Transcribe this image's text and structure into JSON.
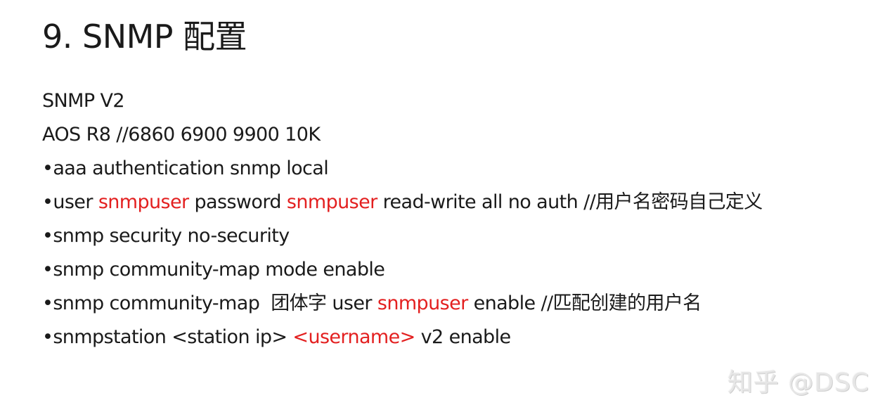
{
  "title": "9. SNMP 配置",
  "lines": [
    [
      {
        "text": "SNMP V2"
      }
    ],
    [
      {
        "text": "AOS R8 //6860 6900 9900 10K"
      }
    ],
    [
      {
        "text": "•aaa authentication snmp local"
      }
    ],
    [
      {
        "text": "•user "
      },
      {
        "text": "snmpuser",
        "highlight": true
      },
      {
        "text": " password "
      },
      {
        "text": "snmpuser",
        "highlight": true
      },
      {
        "text": " read-write all no auth //用户名密码自己定义"
      }
    ],
    [
      {
        "text": "•snmp security no-security"
      }
    ],
    [
      {
        "text": "•snmp community-map mode enable"
      }
    ],
    [
      {
        "text": "•snmp community-map  团体字 user "
      },
      {
        "text": "snmpuser",
        "highlight": true
      },
      {
        "text": " enable //匹配创建的用户名"
      }
    ],
    [
      {
        "text": "•snmpstation <station ip> "
      },
      {
        "text": "<username>",
        "highlight": true
      },
      {
        "text": " v2 enable"
      }
    ]
  ],
  "watermark": "知乎 @DSC",
  "colors": {
    "text": "#1a1a1a",
    "highlight": "#e32020",
    "background": "#ffffff"
  }
}
